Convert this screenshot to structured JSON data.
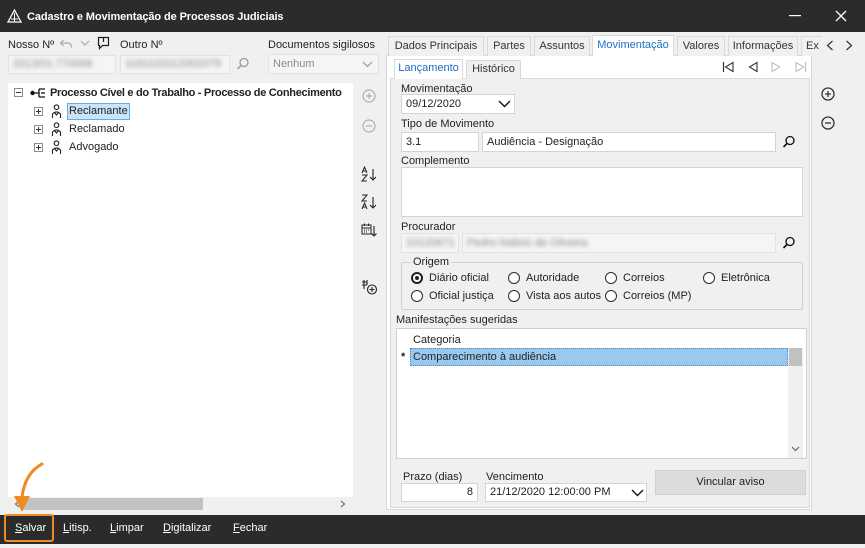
{
  "window": {
    "title": "Cadastro e Movimentação de Processos Judiciais",
    "app_icon": "scales-icon",
    "controls": [
      "minimize-icon",
      "close-icon"
    ]
  },
  "header": {
    "nosso_label": "Nosso Nº",
    "nosso_value": "2013/01.770006",
    "nosso_icons": [
      "undo-icon",
      "chevron-down-icon",
      "note-icon"
    ],
    "outro_label": "Outro Nº",
    "outro_value": "1181102013302079",
    "docs_label": "Documentos sigilosos",
    "docs_value": "Nenhum"
  },
  "tree": {
    "root_label": "Processo Cível e do Trabalho - Processo de Conhecimento",
    "root_expanded": true,
    "selected_index": 0,
    "children": [
      {
        "label": "Reclamante",
        "expanded": false
      },
      {
        "label": "Reclamado",
        "expanded": false
      },
      {
        "label": "Advogado",
        "expanded": false
      }
    ]
  },
  "tree_tools": [
    "add-circle-icon",
    "remove-circle-icon",
    "sort-az-icon",
    "sort-za-icon",
    "sort-date-icon",
    "add-party-icon"
  ],
  "tabs": {
    "active_index": 3,
    "items": [
      {
        "label": "Dados Principais"
      },
      {
        "label": "Partes"
      },
      {
        "label": "Assuntos"
      },
      {
        "label": "Movimentação"
      },
      {
        "label": "Valores"
      },
      {
        "label": "Informações"
      },
      {
        "label": "Ex"
      }
    ]
  },
  "subtabs": {
    "active_index": 0,
    "items": [
      {
        "label": "Lançamento"
      },
      {
        "label": "Histórico"
      }
    ]
  },
  "record_nav": [
    "first-record-icon",
    "prev-record-icon",
    "next-record-icon",
    "last-record-icon"
  ],
  "form": {
    "movimentacao_label": "Movimentação",
    "movimentacao_value": "09/12/2020",
    "tipo_label": "Tipo de Movimento",
    "tipo_code": "3.1",
    "tipo_desc": "Audiência - Designação",
    "complemento_label": "Complemento",
    "procurador_label": "Procurador",
    "procurador_code": "10120671",
    "procurador_name": "Pedro Nabrio de Oliveira",
    "origem": {
      "label": "Origem",
      "selected_index": 0,
      "options": [
        "Diário oficial",
        "Autoridade",
        "Correios",
        "Eletrônica",
        "Oficial justiça",
        "Vista aos autos",
        "Correios (MP)"
      ]
    }
  },
  "manifestacoes": {
    "label": "Manifestações sugeridas",
    "column": "Categoria",
    "rows": [
      {
        "marker": "*",
        "categoria": "Comparecimento à audiência"
      }
    ]
  },
  "prazo": {
    "label": "Prazo (dias)",
    "value": "8"
  },
  "vencimento": {
    "label": "Vencimento",
    "value": "21/12/2020 12:00:00 PM"
  },
  "actions": {
    "vincular_label": "Vincular aviso"
  },
  "footer": {
    "highlighted_index": 0,
    "buttons": [
      {
        "label": "Salvar"
      },
      {
        "label": "Litisp."
      },
      {
        "label": "Limpar"
      },
      {
        "label": "Digitalizar"
      },
      {
        "label": "Fechar"
      }
    ]
  },
  "theme": {
    "titlebar": "#2b2b2b",
    "accent": "#1a6fc4",
    "annotation": "#f08a24",
    "selection": "#99c9ef"
  }
}
